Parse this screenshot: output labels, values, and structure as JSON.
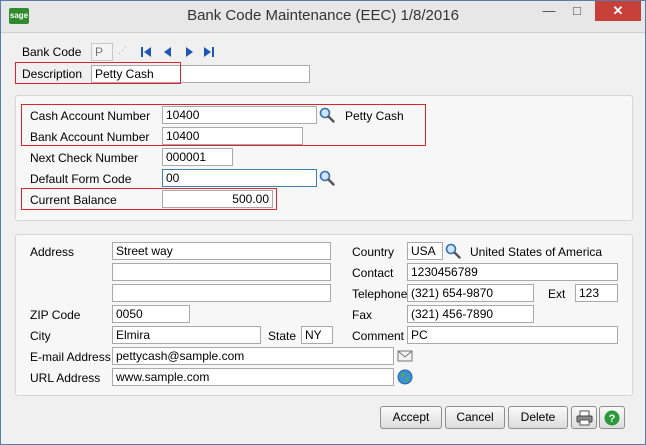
{
  "window": {
    "title": "Bank Code Maintenance (EEC) 1/8/2016",
    "logo_text": "sage",
    "minimize": "—",
    "maximize": "□",
    "close": "✕"
  },
  "header": {
    "bank_code_label": "Bank Code",
    "bank_code_value": "P",
    "description_label": "Description",
    "description_value": "Petty Cash"
  },
  "account": {
    "cash_account_label": "Cash Account Number",
    "cash_account_value": "10400",
    "cash_account_desc": "Petty Cash",
    "bank_account_label": "Bank Account Number",
    "bank_account_value": "10400",
    "next_check_label": "Next Check Number",
    "next_check_value": "000001",
    "default_form_label": "Default Form Code",
    "default_form_value": "00",
    "current_balance_label": "Current Balance",
    "current_balance_value": "500.00"
  },
  "address": {
    "address_label": "Address",
    "address_line1": "Street way",
    "address_line2": "",
    "address_line3": "",
    "zip_label": "ZIP Code",
    "zip_value": "0050",
    "city_label": "City",
    "city_value": "Elmira",
    "state_label": "State",
    "state_value": "NY",
    "email_label": "E-mail Address",
    "email_value": "pettycash@sample.com",
    "url_label": "URL Address",
    "url_value": "www.sample.com",
    "country_label": "Country",
    "country_value": "USA",
    "country_name": "United States of America",
    "contact_label": "Contact",
    "contact_value": "1230456789",
    "telephone_label": "Telephone",
    "telephone_value": "(321) 654-9870",
    "ext_label": "Ext",
    "ext_value": "123",
    "fax_label": "Fax",
    "fax_value": "(321) 456-7890",
    "comment_label": "Comment",
    "comment_value": "PC"
  },
  "buttons": {
    "accept": "Accept",
    "cancel": "Cancel",
    "delete": "Delete"
  },
  "colors": {
    "highlight": "#d9262b",
    "title_close": "#c7403a",
    "nav_arrow": "#1f56b5"
  }
}
